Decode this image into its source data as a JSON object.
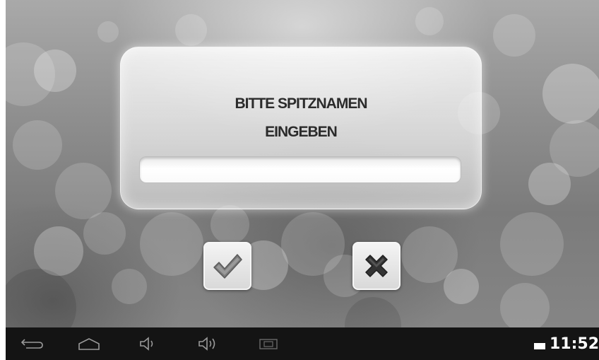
{
  "dialog": {
    "prompt_line1": "BITTE SPITZNAMEN",
    "prompt_line2": "EINGEBEN",
    "nickname_value": "",
    "nickname_placeholder": ""
  },
  "actions": {
    "confirm_icon": "checkmark-icon",
    "cancel_icon": "x-icon"
  },
  "navbar": {
    "icons": [
      "back-icon",
      "home-icon",
      "volume-down-icon",
      "volume-up-icon",
      "screenshot-icon"
    ],
    "time": "11:52",
    "battery_icon": "battery-icon"
  },
  "colors": {
    "navbar_bg": "#141414",
    "confirm_check": "#7a7a7a",
    "cancel_x": "#333333"
  }
}
